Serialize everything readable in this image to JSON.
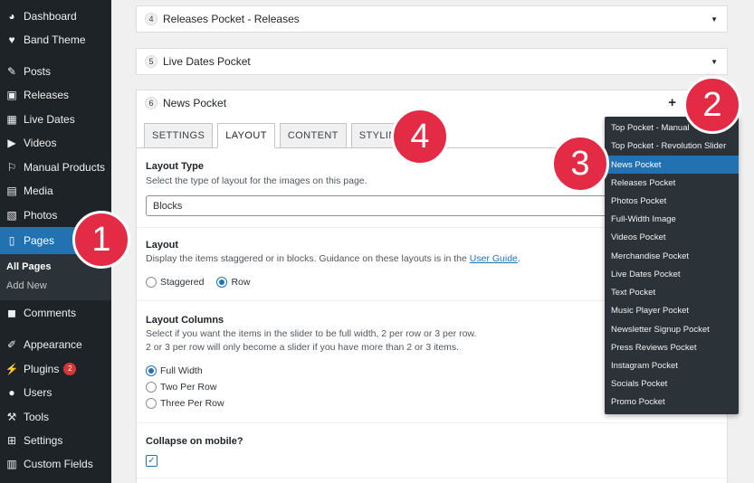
{
  "sidebar": {
    "items": [
      {
        "label": "Dashboard",
        "icon": "dashboard-icon",
        "glyph": "◕"
      },
      {
        "label": "Band Theme",
        "icon": "heart-icon",
        "glyph": "♥"
      },
      {
        "label": "Posts",
        "icon": "pushpin-icon",
        "glyph": "✎"
      },
      {
        "label": "Releases",
        "icon": "releases-icon",
        "glyph": "▣"
      },
      {
        "label": "Live Dates",
        "icon": "calendar-icon",
        "glyph": "▦"
      },
      {
        "label": "Videos",
        "icon": "video-icon",
        "glyph": "▶"
      },
      {
        "label": "Manual Products",
        "icon": "cart-icon",
        "glyph": "⚐"
      },
      {
        "label": "Media",
        "icon": "media-icon",
        "glyph": "▤"
      },
      {
        "label": "Photos",
        "icon": "photos-icon",
        "glyph": "▧"
      },
      {
        "label": "Pages",
        "icon": "pages-icon",
        "glyph": "▯"
      },
      {
        "label": "Comments",
        "icon": "comment-icon",
        "glyph": "◼"
      },
      {
        "label": "Appearance",
        "icon": "brush-icon",
        "glyph": "✐"
      },
      {
        "label": "Plugins",
        "icon": "plugin-icon",
        "glyph": "⚡",
        "badge": "2"
      },
      {
        "label": "Users",
        "icon": "users-icon",
        "glyph": "●"
      },
      {
        "label": "Tools",
        "icon": "wrench-icon",
        "glyph": "⚒"
      },
      {
        "label": "Settings",
        "icon": "settings-icon",
        "glyph": "⊞"
      },
      {
        "label": "Custom Fields",
        "icon": "fields-icon",
        "glyph": "▥"
      }
    ],
    "submenu": [
      "All Pages",
      "Add New"
    ]
  },
  "pockets": [
    {
      "num": "4",
      "label": "Releases Pocket - Releases"
    },
    {
      "num": "5",
      "label": "Live Dates Pocket"
    },
    {
      "num": "6",
      "label": "News Pocket",
      "plus": "+"
    }
  ],
  "tabs": [
    "SETTINGS",
    "LAYOUT",
    "CONTENT",
    "STYLING"
  ],
  "layout_type": {
    "title": "Layout Type",
    "desc": "Select the type of layout for the images on this page.",
    "value": "Blocks"
  },
  "layout": {
    "title": "Layout",
    "desc": "Display the items staggered or in blocks. Guidance on these layouts is in the",
    "link": "User Guide",
    "desc_end": ".",
    "options": [
      "Staggered",
      "Row"
    ],
    "selected": "Row"
  },
  "layout_columns": {
    "title": "Layout Columns",
    "desc1": "Select if you want the items in the slider to be full width, 2 per row or 3 per row.",
    "desc2": "2 or 3 per row will only become a slider if you have more than 2 or 3 items.",
    "options": [
      "Full Width",
      "Two Per Row",
      "Three Per Row"
    ],
    "selected": "Full Width"
  },
  "collapse": {
    "title": "Collapse on mobile?",
    "checked": true,
    "check_glyph": "✓"
  },
  "dropdown": {
    "items": [
      "Top Pocket - Manual",
      "Top Pocket - Revolution Slider",
      "News Pocket",
      "Releases Pocket",
      "Photos Pocket",
      "Full-Width Image",
      "Videos Pocket",
      "Merchandise Pocket",
      "Live Dates Pocket",
      "Text Pocket",
      "Music Player Pocket",
      "Newsletter Signup Pocket",
      "Press Reviews Pocket",
      "Instagram Pocket",
      "Socials Pocket",
      "Promo Pocket"
    ],
    "highlighted": "News Pocket"
  },
  "markers": [
    "1",
    "2",
    "3",
    "4"
  ],
  "colors": {
    "accent": "#2271b1",
    "marker": "#e32b45",
    "sidebar": "#1d2327"
  }
}
